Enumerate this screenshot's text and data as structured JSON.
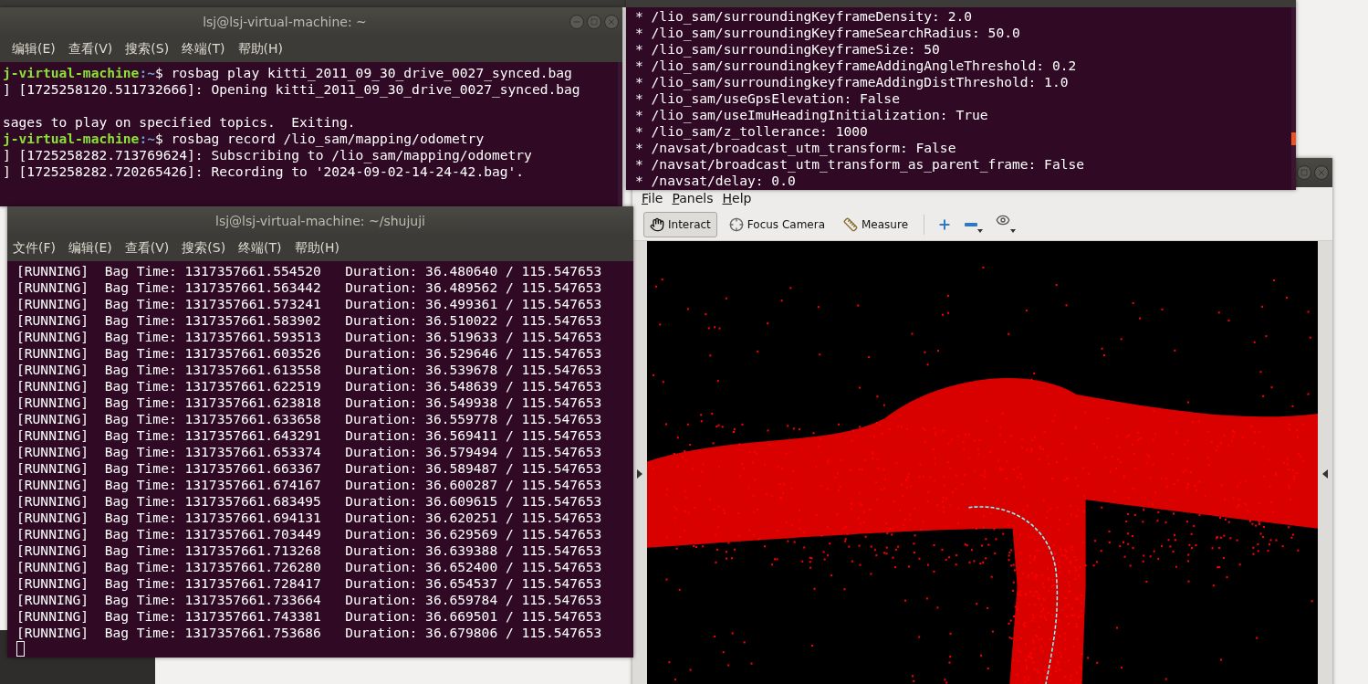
{
  "terminal_home": {
    "title": "lsj@lsj-virtual-machine: ~",
    "menu": [
      "编辑(E)",
      "查看(V)",
      "搜索(S)",
      "终端(T)",
      "帮助(H)"
    ],
    "lines": [
      {
        "kind": "prompt",
        "host": "j-virtual-machine",
        "path": ":~",
        "command": "$ rosbag play kitti_2011_09_30_drive_0027_synced.bag"
      },
      {
        "kind": "output",
        "text": "] [1725258120.511732666]: Opening kitti_2011_09_30_drive_0027_synced.bag"
      },
      {
        "kind": "blank"
      },
      {
        "kind": "output",
        "text": "sages to play on specified topics.  Exiting."
      },
      {
        "kind": "prompt",
        "host": "j-virtual-machine",
        "path": ":~",
        "command": "$ rosbag record /lio_sam/mapping/odometry"
      },
      {
        "kind": "output",
        "text": "] [1725258282.713769624]: Subscribing to /lio_sam/mapping/odometry"
      },
      {
        "kind": "output",
        "text": "] [1725258282.720265426]: Recording to '2024-09-02-14-24-42.bag'."
      }
    ]
  },
  "terminal_params": {
    "lines": [
      "* /lio_sam/surroundingKeyframeDensity: 2.0",
      "* /lio_sam/surroundingKeyframeSearchRadius: 50.0",
      "* /lio_sam/surroundingKeyframeSize: 50",
      "* /lio_sam/surroundingkeyframeAddingAngleThreshold: 0.2",
      "* /lio_sam/surroundingkeyframeAddingDistThreshold: 1.0",
      "* /lio_sam/useGpsElevation: False",
      "* /lio_sam/useImuHeadingInitialization: True",
      "* /lio_sam/z_tollerance: 1000",
      "* /navsat/broadcast_utm_transform: False",
      "* /navsat/broadcast_utm_transform_as_parent_frame: False",
      "* /navsat/delay: 0.0"
    ]
  },
  "terminal_shujuji": {
    "title": "lsj@lsj-virtual-machine: ~/shujuji",
    "menu": [
      "文件(F)",
      "编辑(E)",
      "查看(V)",
      "搜索(S)",
      "终端(T)",
      "帮助(H)"
    ],
    "lines": [
      "[RUNNING]  Bag Time: 1317357661.554520   Duration: 36.480640 / 115.547653",
      "[RUNNING]  Bag Time: 1317357661.563442   Duration: 36.489562 / 115.547653",
      "[RUNNING]  Bag Time: 1317357661.573241   Duration: 36.499361 / 115.547653",
      "[RUNNING]  Bag Time: 1317357661.583902   Duration: 36.510022 / 115.547653",
      "[RUNNING]  Bag Time: 1317357661.593513   Duration: 36.519633 / 115.547653",
      "[RUNNING]  Bag Time: 1317357661.603526   Duration: 36.529646 / 115.547653",
      "[RUNNING]  Bag Time: 1317357661.613558   Duration: 36.539678 / 115.547653",
      "[RUNNING]  Bag Time: 1317357661.622519   Duration: 36.548639 / 115.547653",
      "[RUNNING]  Bag Time: 1317357661.623818   Duration: 36.549938 / 115.547653",
      "[RUNNING]  Bag Time: 1317357661.633658   Duration: 36.559778 / 115.547653",
      "[RUNNING]  Bag Time: 1317357661.643291   Duration: 36.569411 / 115.547653",
      "[RUNNING]  Bag Time: 1317357661.653374   Duration: 36.579494 / 115.547653",
      "[RUNNING]  Bag Time: 1317357661.663367   Duration: 36.589487 / 115.547653",
      "[RUNNING]  Bag Time: 1317357661.674167   Duration: 36.600287 / 115.547653",
      "[RUNNING]  Bag Time: 1317357661.683495   Duration: 36.609615 / 115.547653",
      "[RUNNING]  Bag Time: 1317357661.694131   Duration: 36.620251 / 115.547653",
      "[RUNNING]  Bag Time: 1317357661.703449   Duration: 36.629569 / 115.547653",
      "[RUNNING]  Bag Time: 1317357661.713268   Duration: 36.639388 / 115.547653",
      "[RUNNING]  Bag Time: 1317357661.726280   Duration: 36.652400 / 115.547653",
      "[RUNNING]  Bag Time: 1317357661.728417   Duration: 36.654537 / 115.547653",
      "[RUNNING]  Bag Time: 1317357661.733664   Duration: 36.659784 / 115.547653",
      "[RUNNING]  Bag Time: 1317357661.743381   Duration: 36.669501 / 115.547653",
      "[RUNNING]  Bag Time: 1317357661.753686   Duration: 36.679806 / 115.547653"
    ]
  },
  "rviz": {
    "menu": [
      "File",
      "Panels",
      "Help"
    ],
    "tools": [
      {
        "kind": "interact",
        "label": "Interact",
        "selected": true
      },
      {
        "kind": "focus",
        "label": "Focus Camera",
        "selected": false
      },
      {
        "kind": "measure",
        "label": "Measure",
        "selected": false
      }
    ]
  }
}
